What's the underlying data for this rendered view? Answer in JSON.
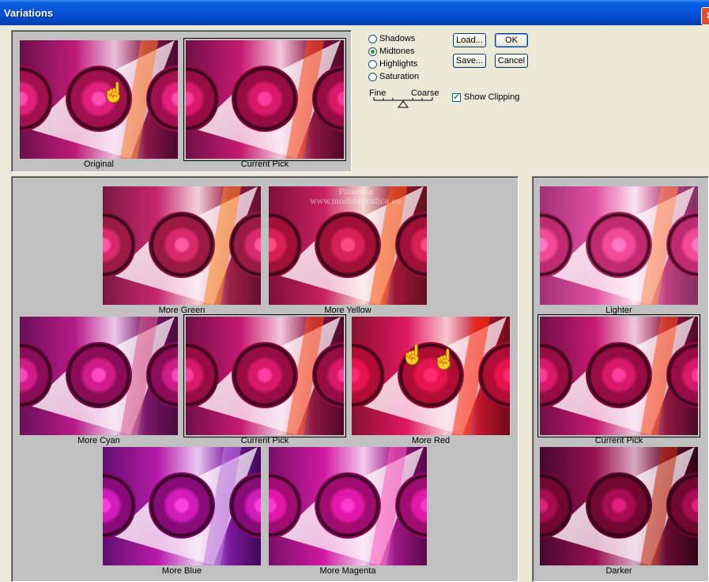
{
  "window": {
    "title": "Variations",
    "close_glyph": "✕"
  },
  "tones": {
    "options": [
      {
        "label": "Shadows",
        "selected": false
      },
      {
        "label": "Midtones",
        "selected": true
      },
      {
        "label": "Highlights",
        "selected": false
      },
      {
        "label": "Saturation",
        "selected": false
      }
    ]
  },
  "buttons": {
    "load": "Load...",
    "save": "Save...",
    "ok": "OK",
    "cancel": "Cancel"
  },
  "scale": {
    "fine": "Fine",
    "coarse": "Coarse",
    "position": 0.5
  },
  "show_clipping": {
    "label": "Show Clipping",
    "checked": true
  },
  "top_panel": {
    "original": "Original",
    "current_pick": "Current Pick"
  },
  "color_panel": {
    "watermark_line1": "Pinuccia",
    "watermark_line2": "www.modidegrafica.eu",
    "more_green": "More Green",
    "more_yellow": "More Yellow",
    "more_cyan": "More Cyan",
    "current_pick": "Current Pick",
    "more_red": "More Red",
    "more_blue": "More Blue",
    "more_magenta": "More Magenta"
  },
  "brightness_panel": {
    "lighter": "Lighter",
    "current_pick": "Current Pick",
    "darker": "Darker"
  },
  "icons": {
    "pointer": "hand-pointer-icon",
    "close": "close-icon"
  },
  "colors": {
    "titlebar": "#0550d8",
    "dialog_bg": "#ece9d8",
    "panel_bg": "#c0c0c0",
    "image_magenta": "#d0106a",
    "image_dark": "#5a0828"
  }
}
